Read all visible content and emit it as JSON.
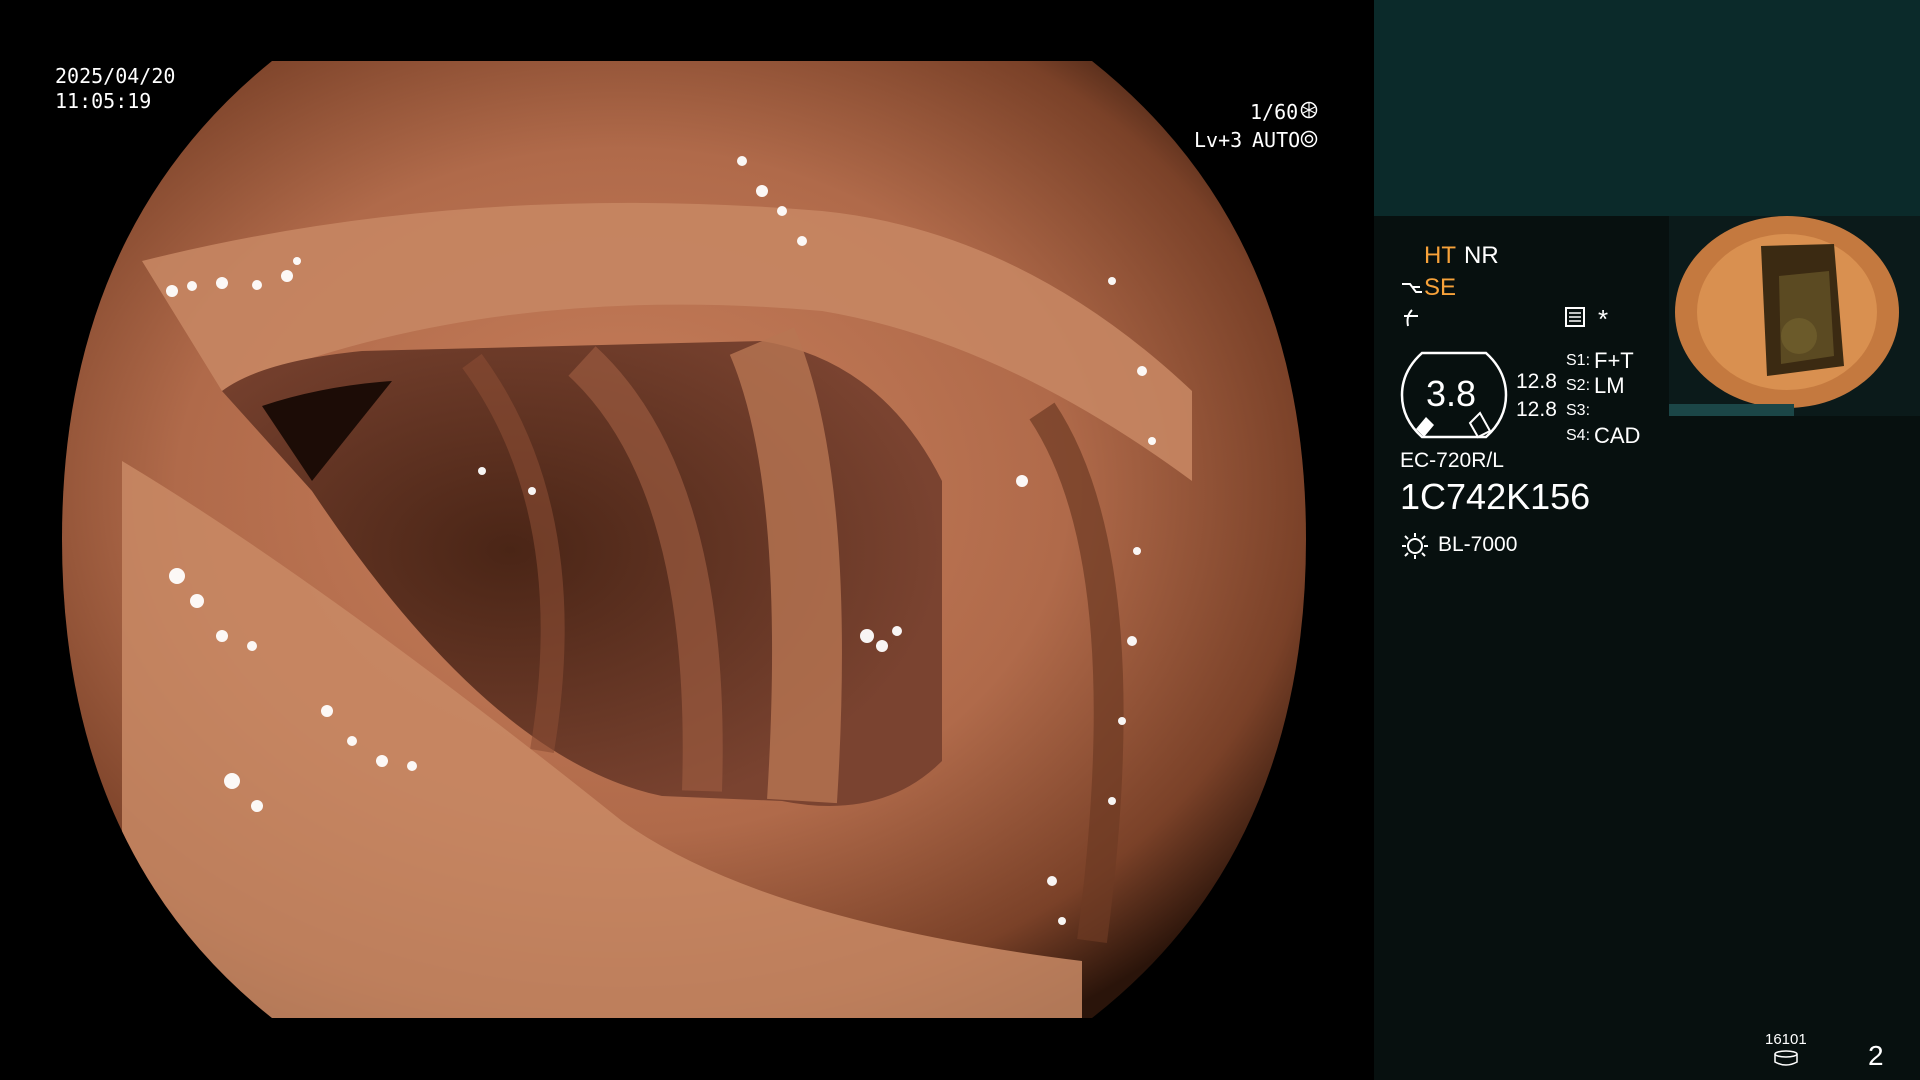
{
  "overlay": {
    "date": "2025/04/20",
    "time": "11:05:19",
    "shutter": "1/60",
    "level": "Lv+3",
    "mode": "AUTO"
  },
  "panel": {
    "ht": "HT",
    "nr": "NR",
    "se": "SE",
    "zoom_value": "3.8",
    "value_1": "12.8",
    "value_2": "12.8",
    "s1_label": "S1:",
    "s1_value": "F+T",
    "s2_label": "S2:",
    "s2_value": "LM",
    "s3_label": "S3:",
    "s3_value": "",
    "s4_label": "S4:",
    "s4_value": "CAD",
    "scope_model": "EC-720R/L",
    "serial": "1C742K156",
    "light_source": "BL-7000",
    "storage_count": "16101",
    "page_number": "2"
  },
  "colors": {
    "accent_orange": "#f7a23a",
    "panel_bg": "#07100f",
    "panel_top_bg": "#0b2a2a"
  }
}
